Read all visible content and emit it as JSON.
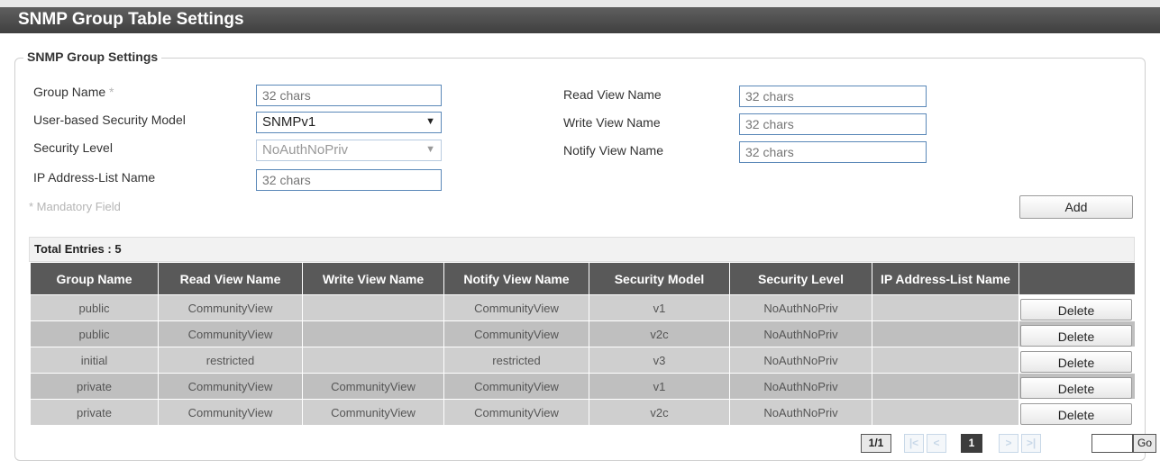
{
  "page": {
    "title": "SNMP Group Table Settings"
  },
  "section": {
    "legend": "SNMP Group Settings"
  },
  "form": {
    "group_name": {
      "label": "Group Name",
      "mandatory_mark": "*",
      "placeholder": "32 chars"
    },
    "security_model": {
      "label": "User-based Security Model",
      "value": "SNMPv1"
    },
    "security_level": {
      "label": "Security Level",
      "value": "NoAuthNoPriv"
    },
    "ip_list_name": {
      "label": "IP Address-List Name",
      "placeholder": "32 chars"
    },
    "read_view": {
      "label": "Read View Name",
      "placeholder": "32 chars"
    },
    "write_view": {
      "label": "Write View Name",
      "placeholder": "32 chars"
    },
    "notify_view": {
      "label": "Notify View Name",
      "placeholder": "32 chars"
    },
    "mandatory_note": "* Mandatory Field",
    "add_label": "Add"
  },
  "table": {
    "total_label": "Total Entries : 5",
    "headers": [
      "Group Name",
      "Read View Name",
      "Write View Name",
      "Notify View Name",
      "Security Model",
      "Security Level",
      "IP Address-List Name",
      ""
    ],
    "rows": [
      {
        "group": "public",
        "read": "CommunityView",
        "write": "",
        "notify": "CommunityView",
        "model": "v1",
        "level": "NoAuthNoPriv",
        "ip": "",
        "action": "Delete"
      },
      {
        "group": "public",
        "read": "CommunityView",
        "write": "",
        "notify": "CommunityView",
        "model": "v2c",
        "level": "NoAuthNoPriv",
        "ip": "",
        "action": "Delete"
      },
      {
        "group": "initial",
        "read": "restricted",
        "write": "",
        "notify": "restricted",
        "model": "v3",
        "level": "NoAuthNoPriv",
        "ip": "",
        "action": "Delete"
      },
      {
        "group": "private",
        "read": "CommunityView",
        "write": "CommunityView",
        "notify": "CommunityView",
        "model": "v1",
        "level": "NoAuthNoPriv",
        "ip": "",
        "action": "Delete"
      },
      {
        "group": "private",
        "read": "CommunityView",
        "write": "CommunityView",
        "notify": "CommunityView",
        "model": "v2c",
        "level": "NoAuthNoPriv",
        "ip": "",
        "action": "Delete"
      }
    ]
  },
  "pager": {
    "count": "1/1",
    "first": "|<",
    "prev": "<",
    "current": "1",
    "next": ">",
    "last": ">|",
    "go_label": "Go",
    "page_input": ""
  },
  "icons": {
    "dropdown": "chevron-down-icon"
  }
}
